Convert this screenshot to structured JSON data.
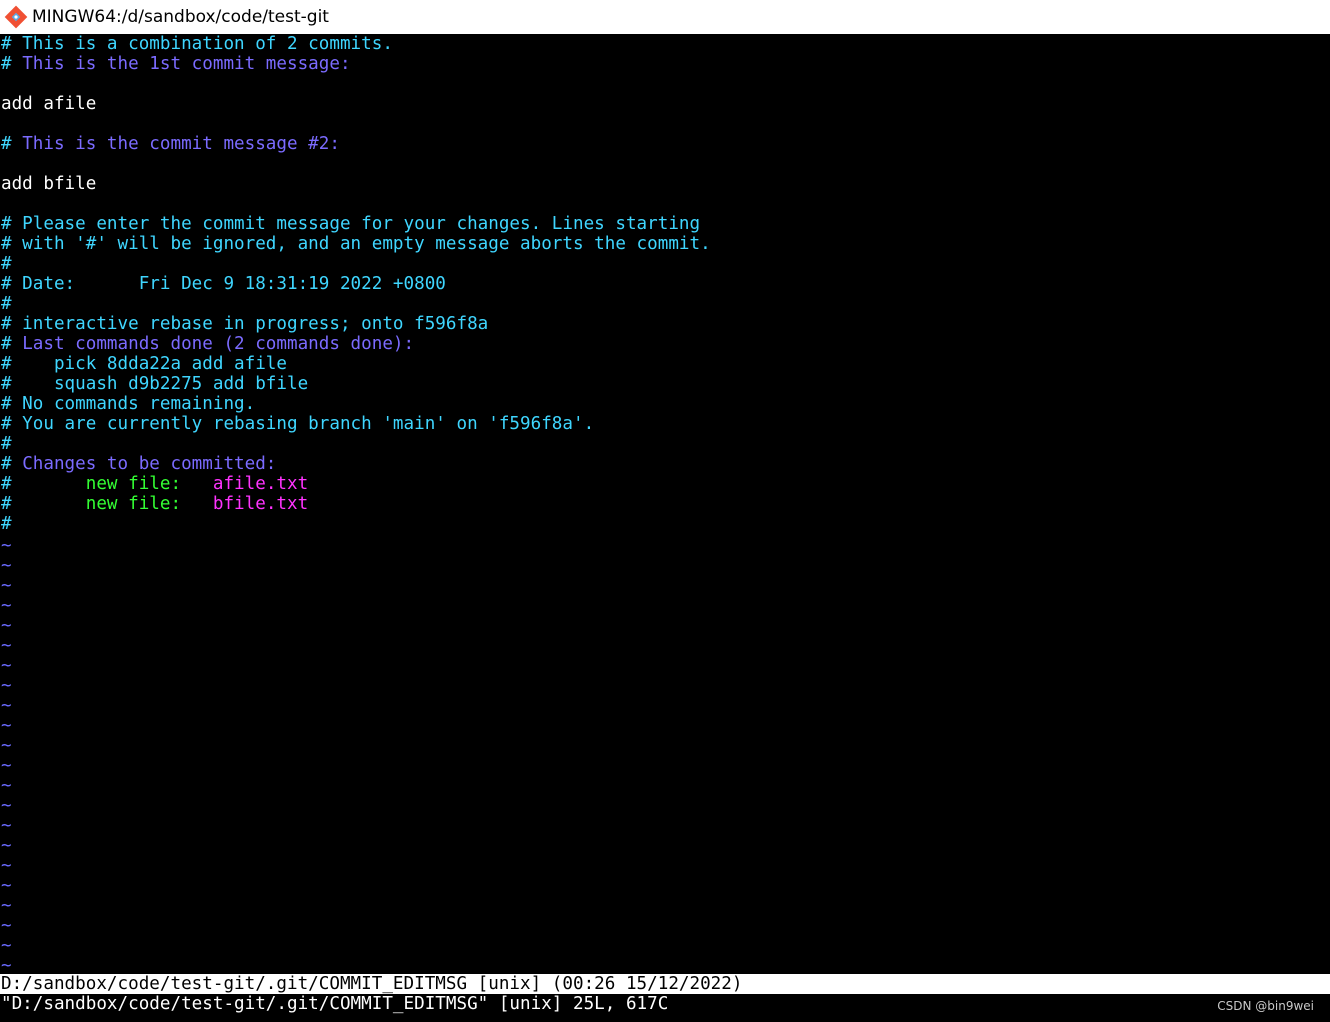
{
  "window": {
    "title": "MINGW64:/d/sandbox/code/test-git",
    "icon": "git-bash-icon"
  },
  "colors": {
    "comment": "#3fd6ff",
    "header": "#7b6bff",
    "text": "#ffffff",
    "new_file": "#33ff33",
    "filename": "#ff33ff",
    "tilde": "#6b6bff",
    "background": "#000000"
  },
  "editor": {
    "lines": [
      [
        {
          "t": "# This is a combination of 2 commits.",
          "c": "comment"
        }
      ],
      [
        {
          "t": "# ",
          "c": "comment"
        },
        {
          "t": "This is the 1st commit message:",
          "c": "header"
        }
      ],
      [],
      [
        {
          "t": "add afile",
          "c": "text"
        }
      ],
      [],
      [
        {
          "t": "# ",
          "c": "comment"
        },
        {
          "t": "This is the commit message #2:",
          "c": "header"
        }
      ],
      [],
      [
        {
          "t": "add bfile",
          "c": "text"
        }
      ],
      [],
      [
        {
          "t": "# Please enter the commit message for your changes. Lines starting",
          "c": "comment"
        }
      ],
      [
        {
          "t": "# with '#' will be ignored, and an empty message aborts the commit.",
          "c": "comment"
        }
      ],
      [
        {
          "t": "#",
          "c": "comment"
        }
      ],
      [
        {
          "t": "# Date:      Fri Dec 9 18:31:19 2022 +0800",
          "c": "comment"
        }
      ],
      [
        {
          "t": "#",
          "c": "comment"
        }
      ],
      [
        {
          "t": "# interactive rebase in progress; onto f596f8a",
          "c": "comment"
        }
      ],
      [
        {
          "t": "# ",
          "c": "comment"
        },
        {
          "t": "Last commands done (2 commands done):",
          "c": "header"
        }
      ],
      [
        {
          "t": "#    pick 8dda22a add afile",
          "c": "comment"
        }
      ],
      [
        {
          "t": "#    squash d9b2275 add bfile",
          "c": "comment"
        }
      ],
      [
        {
          "t": "# No commands remaining.",
          "c": "comment"
        }
      ],
      [
        {
          "t": "# You are currently rebasing branch 'main' on 'f596f8a'.",
          "c": "comment"
        }
      ],
      [
        {
          "t": "#",
          "c": "comment"
        }
      ],
      [
        {
          "t": "# ",
          "c": "comment"
        },
        {
          "t": "Changes to be committed:",
          "c": "header"
        }
      ],
      [
        {
          "t": "#       ",
          "c": "comment"
        },
        {
          "t": "new file:",
          "c": "new_file"
        },
        {
          "t": "   ",
          "c": "comment"
        },
        {
          "t": "afile.txt",
          "c": "filename"
        }
      ],
      [
        {
          "t": "#       ",
          "c": "comment"
        },
        {
          "t": "new file:",
          "c": "new_file"
        },
        {
          "t": "   ",
          "c": "comment"
        },
        {
          "t": "bfile.txt",
          "c": "filename"
        }
      ],
      [
        {
          "t": "#",
          "c": "comment"
        }
      ]
    ],
    "tilde_marker": "~",
    "tilde_count": 22
  },
  "status_line": "D:/sandbox/code/test-git/.git/COMMIT_EDITMSG [unix] (00:26 15/12/2022)",
  "command_line": "\"D:/sandbox/code/test-git/.git/COMMIT_EDITMSG\" [unix] 25L, 617C",
  "watermark": "CSDN @bin9wei"
}
